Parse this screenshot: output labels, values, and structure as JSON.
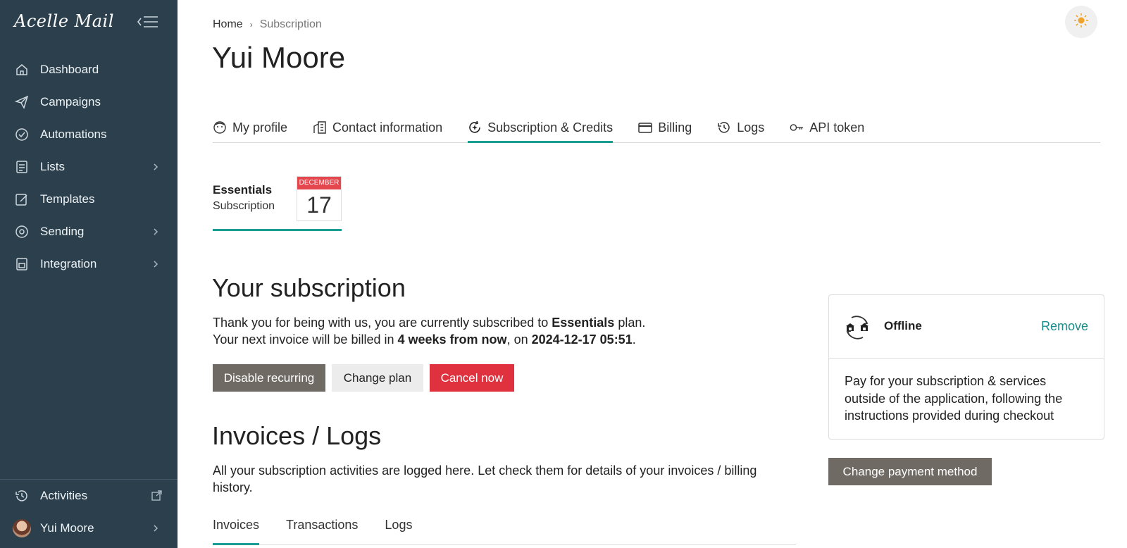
{
  "app": {
    "logo": "Acelle Mail"
  },
  "sidebar": {
    "items": [
      {
        "label": "Dashboard",
        "icon": "home-icon",
        "has_submenu": false
      },
      {
        "label": "Campaigns",
        "icon": "send-icon",
        "has_submenu": false
      },
      {
        "label": "Automations",
        "icon": "automation-icon",
        "has_submenu": false
      },
      {
        "label": "Lists",
        "icon": "list-icon",
        "has_submenu": true
      },
      {
        "label": "Templates",
        "icon": "template-icon",
        "has_submenu": false
      },
      {
        "label": "Sending",
        "icon": "sending-icon",
        "has_submenu": true
      },
      {
        "label": "Integration",
        "icon": "integration-icon",
        "has_submenu": true
      }
    ],
    "activities_label": "Activities",
    "user_name": "Yui Moore"
  },
  "breadcrumb": {
    "home": "Home",
    "current": "Subscription"
  },
  "page_title": "Yui Moore",
  "tabs": [
    {
      "label": "My profile",
      "active": false
    },
    {
      "label": "Contact information",
      "active": false
    },
    {
      "label": "Subscription & Credits",
      "active": true
    },
    {
      "label": "Billing",
      "active": false
    },
    {
      "label": "Logs",
      "active": false
    },
    {
      "label": "API token",
      "active": false
    }
  ],
  "plan": {
    "name": "Essentials",
    "subtitle": "Subscription",
    "month": "DECEMBER",
    "day": "17"
  },
  "subscription": {
    "title": "Your subscription",
    "line1_prefix": "Thank you for being with us, you are currently subscribed to ",
    "line1_plan": "Essentials",
    "line1_suffix": " plan.",
    "line2_prefix": "Your next invoice will be billed in ",
    "line2_period": "4 weeks from now",
    "line2_mid": ", on ",
    "line2_date": "2024-12-17 05:51",
    "line2_suffix": ".",
    "buttons": {
      "disable_recurring": "Disable recurring",
      "change_plan": "Change plan",
      "cancel_now": "Cancel now"
    }
  },
  "invoices": {
    "title": "Invoices / Logs",
    "description": "All your subscription activities are logged here. Let check them for details of your invoices / billing history.",
    "subtabs": [
      {
        "label": "Invoices",
        "active": true
      },
      {
        "label": "Transactions",
        "active": false
      },
      {
        "label": "Logs",
        "active": false
      }
    ]
  },
  "payment": {
    "method_name": "Offline",
    "remove_label": "Remove",
    "description": "Pay for your subscription & services outside of the application, following the instructions provided during checkout",
    "change_label": "Change payment method"
  },
  "colors": {
    "sidebar_bg": "#2b3f4c",
    "accent": "#1a9e94",
    "danger": "#e0313f",
    "button_dark": "#6f6a64"
  }
}
